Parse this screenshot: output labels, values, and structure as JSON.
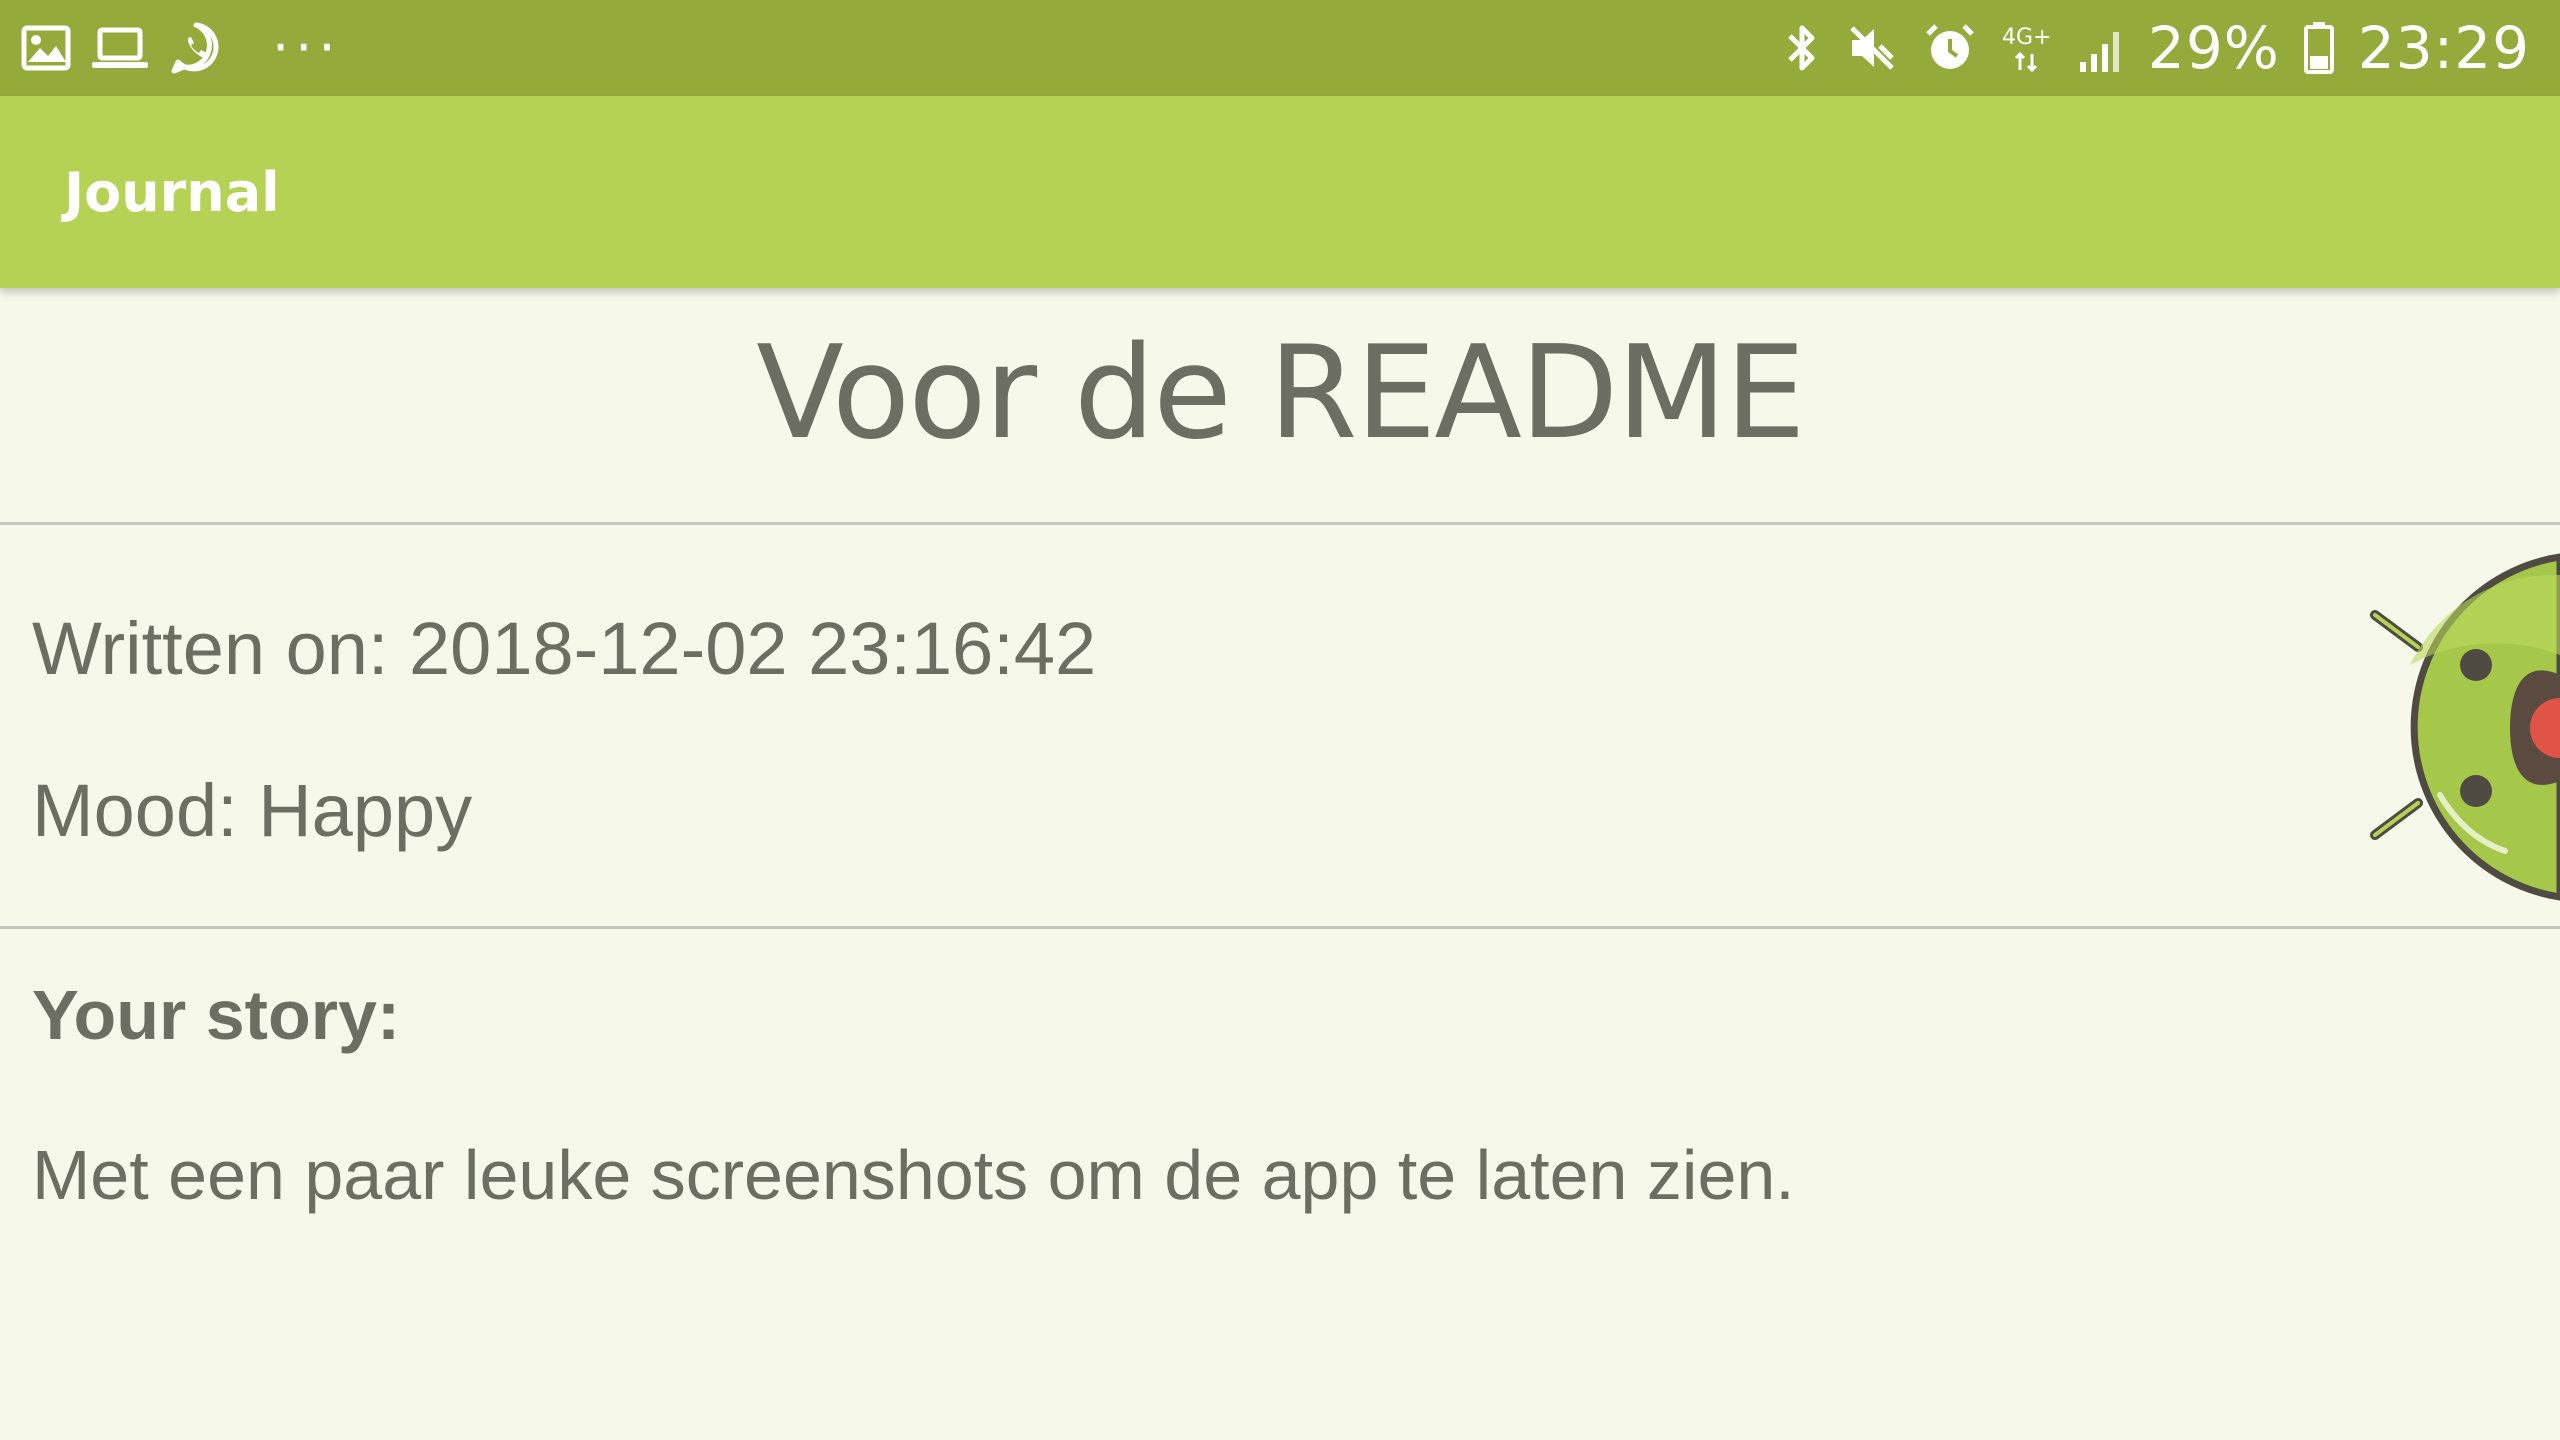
{
  "status_bar": {
    "left_icons": [
      "gallery-icon",
      "laptop-icon",
      "whatsapp-icon"
    ],
    "overflow": "···",
    "right_icons": [
      "bluetooth-icon",
      "mute-icon",
      "alarm-icon"
    ],
    "network": "4G+",
    "battery_percent": "29%",
    "time": "23:29"
  },
  "app_bar": {
    "title": "Journal"
  },
  "entry": {
    "title": "Voor de README",
    "written_on": "Written on: 2018-12-02 23:16:42",
    "mood": "Mood: Happy",
    "mood_icon": "happy-android-face-icon",
    "story_label": "Your story:",
    "story": "Met een paar leuke screenshots om de app te laten zien."
  },
  "colors": {
    "status_bar": "#94ab3c",
    "app_bar": "#b6d255",
    "background": "#f6f8ea",
    "text": "#6b6e60"
  }
}
